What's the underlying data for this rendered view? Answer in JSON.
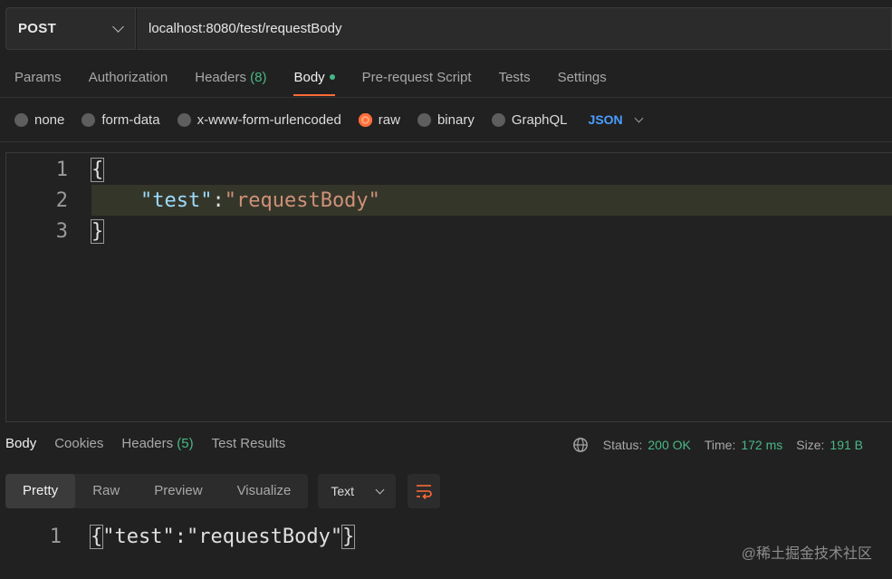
{
  "request": {
    "method": "POST",
    "url": "localhost:8080/test/requestBody"
  },
  "request_tabs": [
    {
      "label": "Params"
    },
    {
      "label": "Authorization"
    },
    {
      "label": "Headers",
      "count": "(8)"
    },
    {
      "label": "Body",
      "active": true
    },
    {
      "label": "Pre-request Script"
    },
    {
      "label": "Tests"
    },
    {
      "label": "Settings"
    }
  ],
  "body_types": {
    "none": "none",
    "form_data": "form-data",
    "urlencoded": "x-www-form-urlencoded",
    "raw": "raw",
    "binary": "binary",
    "graphql": "GraphQL",
    "selected": "raw",
    "language": "JSON"
  },
  "editor": {
    "lines": [
      {
        "num": "1",
        "text": "{"
      },
      {
        "num": "2",
        "key": "\"test\"",
        "colon": ":",
        "value": "\"requestBody\""
      },
      {
        "num": "3",
        "text": "}"
      }
    ]
  },
  "response_tabs": [
    {
      "label": "Body",
      "active": true
    },
    {
      "label": "Cookies"
    },
    {
      "label": "Headers",
      "count": "(5)"
    },
    {
      "label": "Test Results"
    }
  ],
  "status": {
    "status_label": "Status:",
    "status_value": "200 OK",
    "time_label": "Time:",
    "time_value": "172 ms",
    "size_label": "Size:",
    "size_value": "191 B"
  },
  "view_modes": {
    "pretty": "Pretty",
    "raw": "Raw",
    "preview": "Preview",
    "visualize": "Visualize",
    "format": "Text"
  },
  "response_body": {
    "num": "1",
    "open": "{",
    "content": "\"test\":\"requestBody\"",
    "close": "}"
  },
  "watermark": "@稀土掘金技术社区",
  "colors": {
    "accent": "#ff6c37",
    "success": "#49b787",
    "link_blue": "#4b9dff"
  }
}
